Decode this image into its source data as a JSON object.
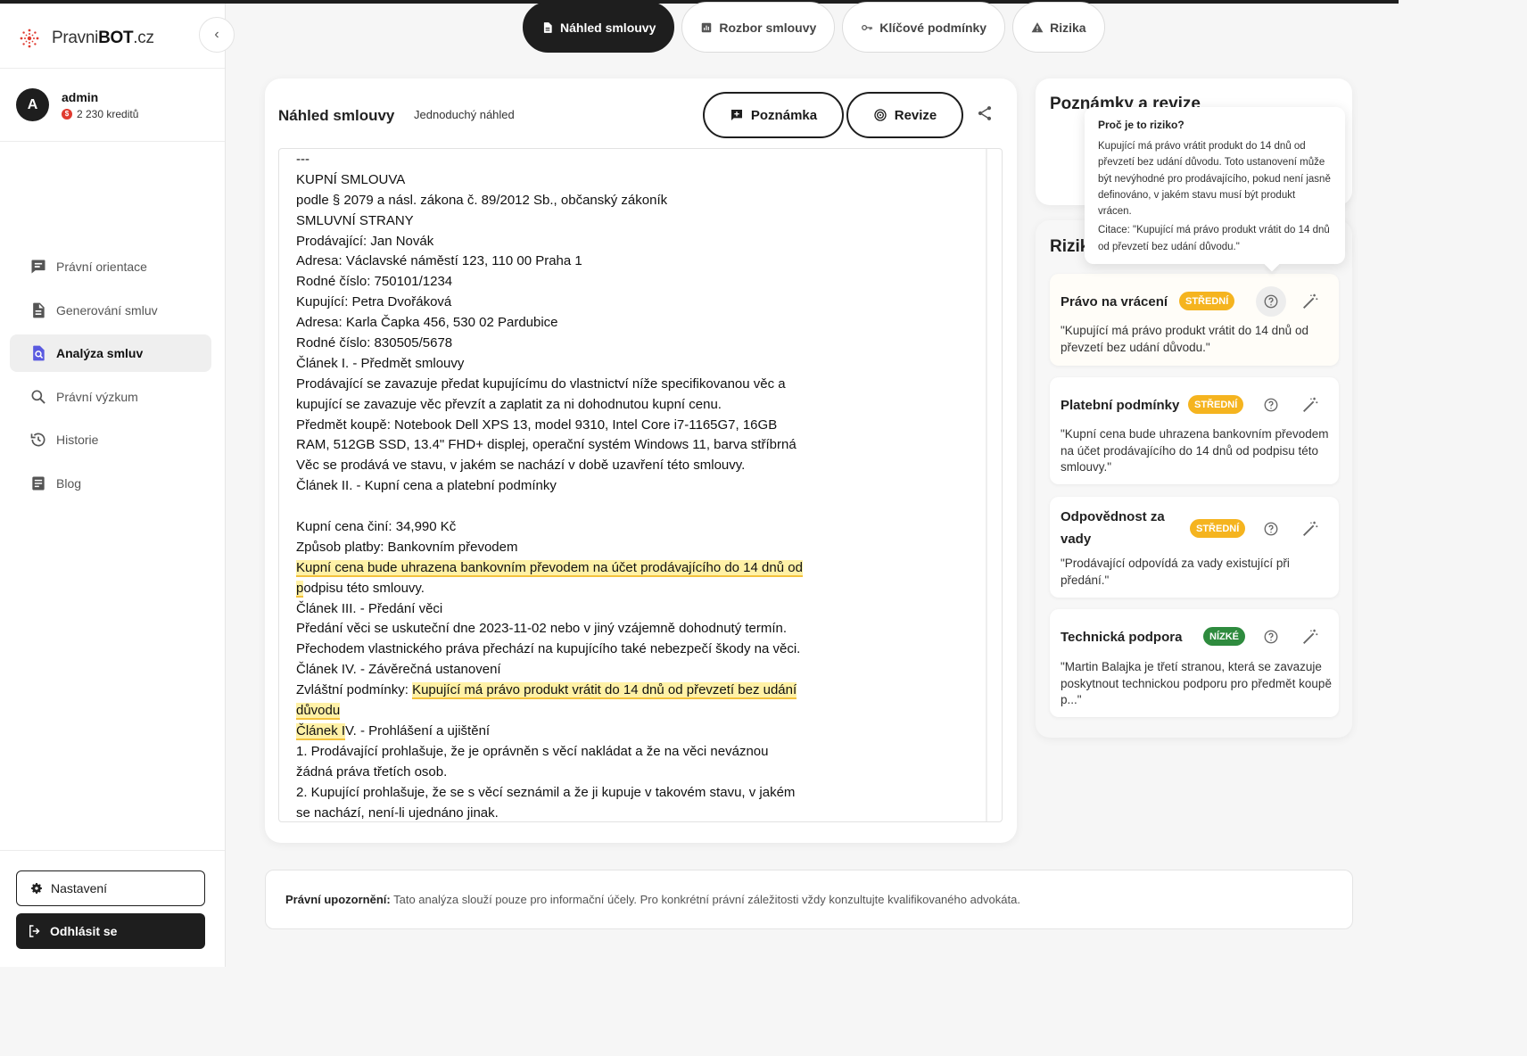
{
  "brand": {
    "name_part1": "Pravni",
    "name_part2": "BOT",
    "name_part3": ".cz"
  },
  "user": {
    "initial": "A",
    "name": "admin",
    "credits": "2 230 kreditů"
  },
  "sidebar": {
    "items": [
      {
        "label": "Právní orientace",
        "icon": "chat-icon"
      },
      {
        "label": "Generování smluv",
        "icon": "document-icon"
      },
      {
        "label": "Analýza smluv",
        "icon": "document-search-icon",
        "active": true
      },
      {
        "label": "Právní výzkum",
        "icon": "search-icon"
      },
      {
        "label": "Historie",
        "icon": "history-icon"
      },
      {
        "label": "Blog",
        "icon": "article-icon"
      }
    ],
    "settings_label": "Nastavení",
    "logout_label": "Odhlásit se"
  },
  "tabs": [
    {
      "label": "Náhled smlouvy",
      "icon": "document-icon",
      "active": true
    },
    {
      "label": "Rozbor smlouvy",
      "icon": "chart-icon"
    },
    {
      "label": "Klíčové podmínky",
      "icon": "key-icon"
    },
    {
      "label": "Rizika",
      "icon": "warning-icon"
    }
  ],
  "preview": {
    "title": "Náhled smlouvy",
    "mode": "Jednoduchý náhled",
    "note_button": "Poznámka",
    "revision_button": "Revize",
    "lines": [
      "---",
      "KUPNÍ SMLOUVA",
      "podle § 2079 a násl. zákona č. 89/2012 Sb., občanský zákoník",
      "SMLUVNÍ STRANY",
      "Prodávající: Jan Novák",
      "Adresa: Václavské náměstí 123, 110 00 Praha 1",
      "Rodné číslo: 750101/1234",
      "Kupující: Petra Dvořáková",
      "Adresa: Karla Čapka 456, 530 02 Pardubice",
      "Rodné číslo: 830505/5678",
      "Článek I. - Předmět smlouvy",
      "Prodávající se zavazuje předat kupujícímu do vlastnictví níže specifikovanou věc a",
      "kupující se zavazuje věc převzít a zaplatit za ni dohodnutou kupní cenu.",
      "Předmět koupě: Notebook Dell XPS 13, model 9310, Intel Core i7-1165G7, 16GB",
      "RAM, 512GB SSD, 13.4\" FHD+ displej, operační systém Windows 11, barva stříbrná",
      "Věc se prodává ve stavu, v jakém se nachází v době uzavření této smlouvy.",
      "Článek II. - Kupní cena a platební podmínky",
      "",
      "Kupní cena činí: 34,990 Kč",
      "Způsob platby: Bankovním převodem"
    ],
    "hl1_text": "Kupní cena bude uhrazena bankovním převodem na účet prodávajícího do 14 dnů od",
    "hl1_p": "p",
    "hl1_rest": "odpisu této smlouvy.",
    "lines2": [
      "Článek III. - Předání věci",
      "Předání věci se uskuteční dne 2023-11-02 nebo v jiný vzájemně dohodnutý termín.",
      "Přechodem vlastnického práva přechází na kupujícího také nebezpečí škody na věci.",
      "Článek IV. - Závěrečná ustanovení"
    ],
    "special_prefix": "Zvláštní podmínky: ",
    "hl2_text": "Kupující má právo produkt vrátit do 14 dnů od převzetí bez udání",
    "hl2_cont": "důvodu",
    "hl3_text": "Článek I",
    "hl3_rest": "V. - Prohlášení a ujištění",
    "lines3": [
      "1. Prodávající prohlašuje, že je oprávněn s věcí nakládat a že na věci neváznou",
      "žádná práva třetích osob.",
      "2. Kupující prohlašuje, že se s věcí seznámil a že ji kupuje v takovém stavu, v jakém",
      "se nachází, není-li ujednáno jinak."
    ]
  },
  "notes_panel": {
    "title": "Poznámky a revize"
  },
  "risks_panel": {
    "title": "Rizika",
    "items": [
      {
        "title": "Právo na vrácení",
        "level": "STŘEDNÍ",
        "quote": "\"Kupující má právo produkt vrátit do 14 dnů od převzetí bez udání důvodu.\""
      },
      {
        "title": "Platební podmínky",
        "level": "STŘEDNÍ",
        "quote": "\"Kupní cena bude uhrazena bankovním převodem na účet prodávajícího do 14 dnů od podpisu této smlouvy.\""
      },
      {
        "title": "Odpovědnost za vady",
        "level": "STŘEDNÍ",
        "quote": "\"Prodávající odpovídá za vady existující při předání.\""
      },
      {
        "title": "Technická podpora",
        "level": "NÍZKÉ",
        "quote": "\"Martin Balajka je třetí stranou, která se zavazuje poskytnout technickou podporu pro předmět koupě p...\""
      }
    ]
  },
  "tooltip": {
    "title": "Proč je to riziko?",
    "text": "Kupující má právo vrátit produkt do 14 dnů od převzetí bez udání důvodu. Toto ustanovení může být nevýhodné pro prodávajícího, pokud není jasně definováno, v jakém stavu musí být produkt vrácen.",
    "citation": "Citace: \"Kupující má právo produkt vrátit do 14 dnů od převzetí bez udání důvodu.\""
  },
  "disclaimer": {
    "label": "Právní upozornění:",
    "text": " Tato analýza slouží pouze pro informační účely. Pro konkrétní právní záležitosti vždy konzultujte kvalifikovaného advokáta."
  },
  "colors": {
    "accent": "#1e1e1e",
    "medium": "#f5b41f",
    "low": "#2e8b3e",
    "highlight": "#fff1a6",
    "logo": "#e03a2f"
  }
}
